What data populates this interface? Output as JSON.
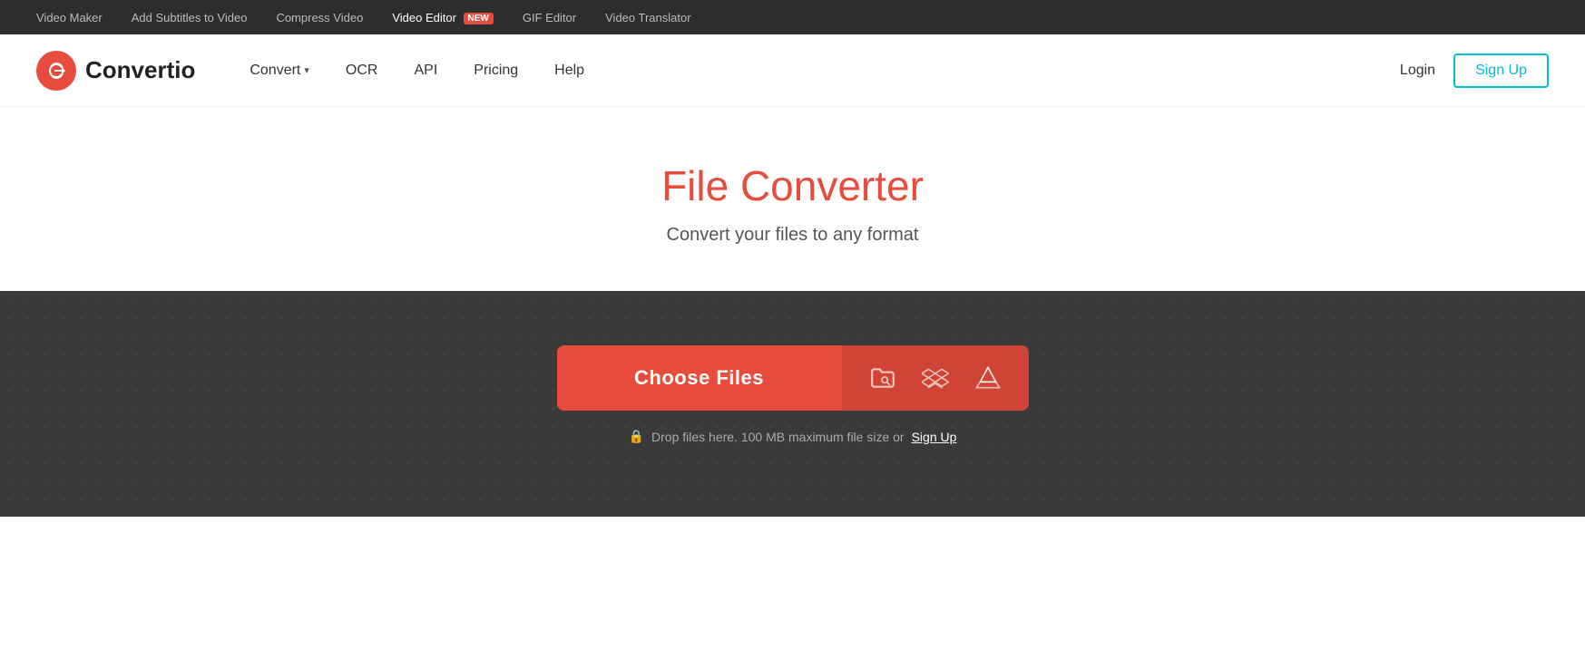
{
  "topbar": {
    "items": [
      {
        "id": "video-maker",
        "label": "Video Maker",
        "active": false,
        "badge": null
      },
      {
        "id": "add-subtitles",
        "label": "Add Subtitles to Video",
        "active": false,
        "badge": null
      },
      {
        "id": "compress-video",
        "label": "Compress Video",
        "active": false,
        "badge": null
      },
      {
        "id": "video-editor",
        "label": "Video Editor",
        "active": true,
        "badge": "NEW"
      },
      {
        "id": "gif-editor",
        "label": "GIF Editor",
        "active": false,
        "badge": null
      },
      {
        "id": "video-translator",
        "label": "Video Translator",
        "active": false,
        "badge": null
      }
    ]
  },
  "header": {
    "logo_text": "Convertio",
    "nav": [
      {
        "id": "convert",
        "label": "Convert",
        "has_dropdown": true
      },
      {
        "id": "ocr",
        "label": "OCR",
        "has_dropdown": false
      },
      {
        "id": "api",
        "label": "API",
        "has_dropdown": false
      },
      {
        "id": "pricing",
        "label": "Pricing",
        "has_dropdown": false
      },
      {
        "id": "help",
        "label": "Help",
        "has_dropdown": false
      }
    ],
    "login_label": "Login",
    "signup_label": "Sign Up"
  },
  "hero": {
    "title": "File Converter",
    "subtitle": "Convert your files to any format"
  },
  "upload": {
    "choose_files_label": "Choose Files",
    "drop_info_text": "Drop files here. 100 MB maximum file size or",
    "signup_link_label": "Sign Up",
    "icons": [
      {
        "id": "folder-icon",
        "tooltip": "Browse files"
      },
      {
        "id": "dropbox-icon",
        "tooltip": "Upload from Dropbox"
      },
      {
        "id": "gdrive-icon",
        "tooltip": "Upload from Google Drive"
      }
    ]
  }
}
